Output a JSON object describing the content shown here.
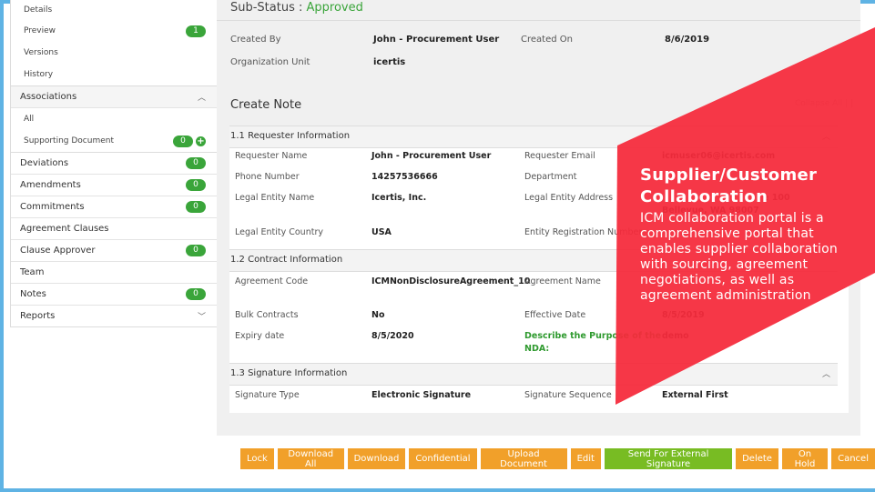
{
  "sidebar": {
    "top_items": [
      {
        "label": "Details",
        "badge": ""
      },
      {
        "label": "Preview",
        "badge": "1"
      },
      {
        "label": "Versions",
        "badge": ""
      },
      {
        "label": "History",
        "badge": ""
      }
    ],
    "associations": {
      "label": "Associations",
      "items": [
        {
          "label": "All"
        },
        {
          "label": "Supporting Document",
          "badge": "0"
        }
      ]
    },
    "rows": [
      {
        "label": "Deviations",
        "badge": "0"
      },
      {
        "label": "Amendments",
        "badge": "0"
      },
      {
        "label": "Commitments",
        "badge": "0"
      },
      {
        "label": "Agreement Clauses",
        "badge": ""
      },
      {
        "label": "Clause Approver",
        "badge": "0"
      },
      {
        "label": "Team",
        "badge": ""
      },
      {
        "label": "Notes",
        "badge": "0"
      },
      {
        "label": "Reports",
        "badge": ""
      }
    ]
  },
  "header": {
    "substatus_label": "Sub-Status : ",
    "substatus_value": "Approved",
    "created_by_label": "Created By",
    "created_by_value": "John - Procurement User",
    "created_on_label": "Created On",
    "created_on_value": "8/6/2019",
    "org_unit_label": "Organization Unit",
    "org_unit_value": "icertis"
  },
  "note": {
    "title": "Create Note",
    "collapse_all": "Collapse All | |",
    "sections": {
      "requester": {
        "title": "1.1 Requester Information",
        "fields": {
          "requester_name_label": "Requester Name",
          "requester_name_value": "John - Procurement User",
          "requester_email_label": "Requester Email",
          "requester_email_value": "icmuser06@icertis.com",
          "phone_label": "Phone Number",
          "phone_value": "14257536666",
          "department_label": "Department",
          "legal_entity_name_label": "Legal Entity Name",
          "legal_entity_name_value": "Icertis, Inc.",
          "legal_entity_address_label": "Legal Entity Address",
          "legal_entity_address_line1": "e 100",
          "legal_entity_address_line2": "Bellevue, WA 98007",
          "legal_entity_country_label": "Legal Entity Country",
          "legal_entity_country_value": "USA",
          "entity_reg_label": "Entity Registration Number"
        }
      },
      "contract": {
        "title": "1.2 Contract Information",
        "fields": {
          "agreement_code_label": "Agreement Code",
          "agreement_code_value": "ICMNonDisclosureAgreement_10",
          "agreement_name_label": "Agreement Name",
          "bulk_label": "Bulk Contracts",
          "bulk_value": "No",
          "effective_label": "Effective Date",
          "effective_value": "8/5/2019",
          "expiry_label": "Expiry date",
          "expiry_value": "8/5/2020",
          "purpose_label_1": "Describe the Purpose of the",
          "purpose_label_2": "NDA:",
          "purpose_value": "demo"
        }
      },
      "signature": {
        "title": "1.3 Signature Information",
        "fields": {
          "sig_type_label": "Signature Type",
          "sig_type_value": "Electronic Signature",
          "sig_seq_label": "Signature Sequence",
          "sig_seq_value": "External First"
        }
      }
    }
  },
  "toolbar": {
    "buttons": [
      "Lock",
      "Download All",
      "Download",
      "Confidential",
      "Upload Document",
      "Edit",
      "Send For External Signature",
      "Delete",
      "On Hold",
      "Cancel"
    ]
  },
  "promo": {
    "title_line1": "Supplier/Customer",
    "title_line2": "Collaboration",
    "body": "ICM collaboration portal is a comprehensive portal that enables supplier collaboration with sourcing, agreement negotiations, as well as agreement administration"
  },
  "colors": {
    "accent_orange": "#f1a02a",
    "accent_green": "#78bc23",
    "badge_green": "#3aa53a",
    "overlay_red": "#f52a3c",
    "frame_blue": "#5fb3e4"
  }
}
